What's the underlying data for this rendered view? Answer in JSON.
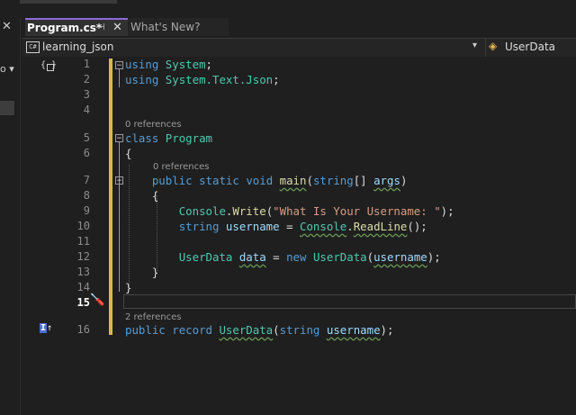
{
  "tabs": [
    {
      "label": "Program.cs*",
      "active": true
    },
    {
      "label": "What's New?",
      "active": false
    }
  ],
  "navbar": {
    "file_icon": "C#",
    "project": "learning_json",
    "class": "UserData"
  },
  "editor": {
    "lines": [
      {
        "n": "1"
      },
      {
        "n": "2"
      },
      {
        "n": "3"
      },
      {
        "n": "4"
      },
      {
        "n": "5"
      },
      {
        "n": "6"
      },
      {
        "n": "7"
      },
      {
        "n": "8"
      },
      {
        "n": "9"
      },
      {
        "n": "10"
      },
      {
        "n": "11"
      },
      {
        "n": "12"
      },
      {
        "n": "13"
      },
      {
        "n": "14"
      },
      {
        "n": "15"
      },
      {
        "n": "16"
      }
    ],
    "codelens": {
      "class_program": "0 references",
      "method_main": "0 references",
      "record_userdata": "2 references"
    },
    "tokens": {
      "using": "using",
      "system": "System",
      "system_text_json": "System.Text.Json",
      "semi": ";",
      "class": "class",
      "program": "Program",
      "lbrace": "{",
      "rbrace": "}",
      "public": "public",
      "static": "static",
      "void": "void",
      "main": "main",
      "string": "string",
      "brackets": "[]",
      "args": "args",
      "console": "Console",
      "write": "Write",
      "prompt": "\"What Is Your Username: \"",
      "username": "username",
      "readline": "ReadLine",
      "userdata": "UserData",
      "data": "data",
      "new": "new",
      "record": "record"
    }
  },
  "colors": {
    "keyword": "#569cd6",
    "type": "#4ec9b0",
    "method": "#dcdcaa",
    "string": "#d69d85",
    "parameter": "#9cdcfe",
    "change_bar": "#d7ba47",
    "active_tab_accent": "#8e6ad8"
  }
}
